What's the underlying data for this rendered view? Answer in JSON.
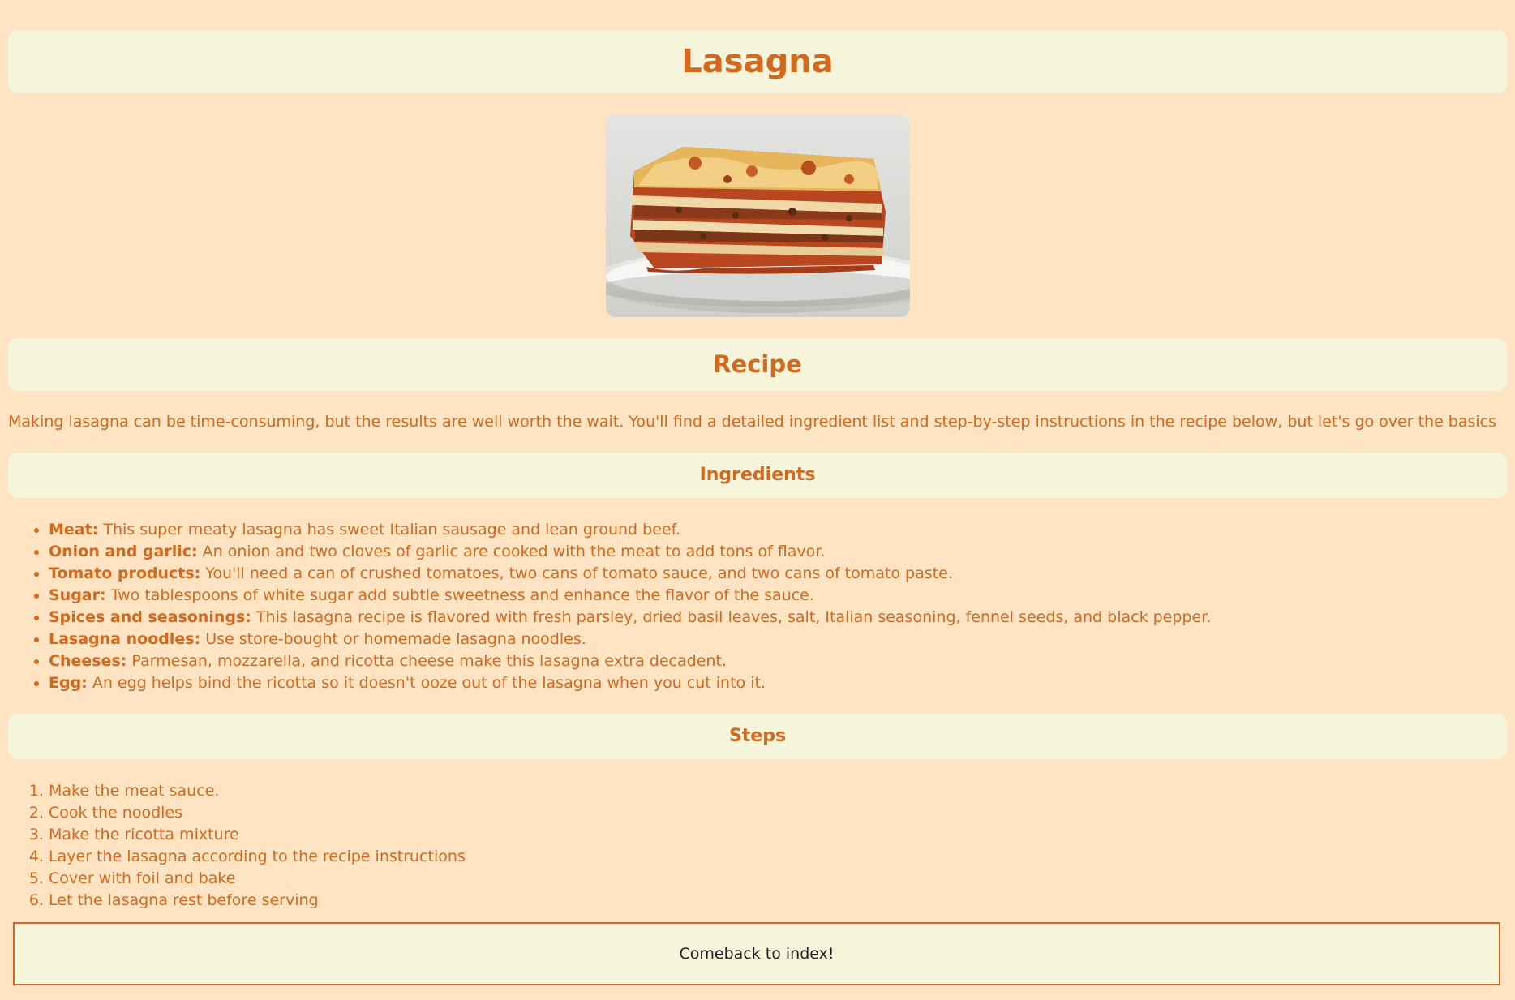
{
  "header": {
    "title": "Lasagna"
  },
  "hero_image": {
    "alt": "lasagna-photo"
  },
  "recipe": {
    "heading": "Recipe",
    "intro": "Making lasagna can be time-consuming, but the results are well worth the wait. You'll find a detailed ingredient list and step-by-step instructions in the recipe below, but let's go over the basics"
  },
  "ingredients": {
    "heading": "Ingredients",
    "items": [
      {
        "name": "Meat:",
        "text": " This super meaty lasagna has sweet Italian sausage and lean ground beef."
      },
      {
        "name": "Onion and garlic:",
        "text": " An onion and two cloves of garlic are cooked with the meat to add tons of flavor."
      },
      {
        "name": "Tomato products:",
        "text": " You'll need a can of crushed tomatoes, two cans of tomato sauce, and two cans of tomato paste."
      },
      {
        "name": "Sugar:",
        "text": " Two tablespoons of white sugar add subtle sweetness and enhance the flavor of the sauce."
      },
      {
        "name": "Spices and seasonings:",
        "text": " This lasagna recipe is flavored with fresh parsley, dried basil leaves, salt, Italian seasoning, fennel seeds, and black pepper."
      },
      {
        "name": "Lasagna noodles:",
        "text": " Use store-bought or homemade lasagna noodles."
      },
      {
        "name": "Cheeses:",
        "text": " Parmesan, mozzarella, and ricotta cheese make this lasagna extra decadent."
      },
      {
        "name": "Egg:",
        "text": " An egg helps bind the ricotta so it doesn't ooze out of the lasagna when you cut into it."
      }
    ]
  },
  "steps": {
    "heading": "Steps",
    "items": [
      "Make the meat sauce.",
      "Cook the noodles",
      "Make the ricotta mixture",
      "Layer the lasagna according to the recipe instructions",
      "Cover with foil and bake",
      "Let the lasagna rest before serving"
    ]
  },
  "footer": {
    "back_label": "Comeback to index!"
  },
  "colors": {
    "background": "#ffe4c4",
    "panel": "#f5f5dc",
    "accent": "#d2691e"
  }
}
